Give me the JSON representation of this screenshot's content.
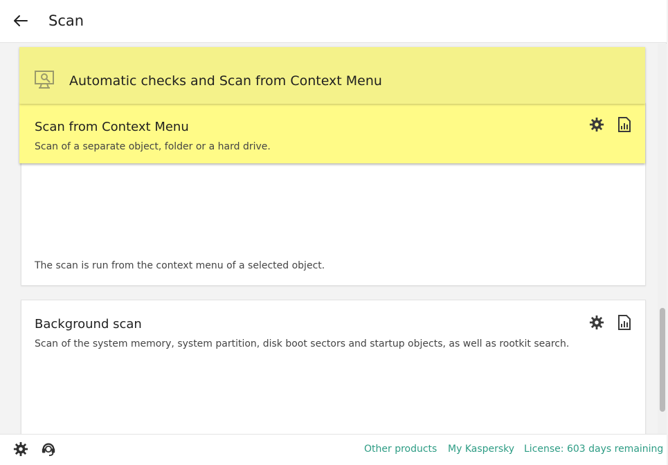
{
  "header": {
    "title": "Scan",
    "back_icon": "back-arrow-icon"
  },
  "section": {
    "title": "Automatic checks and Scan from Context Menu",
    "icon": "monitor-search-icon",
    "color": "#f4f28a"
  },
  "cards": [
    {
      "title": "Scan from Context Menu",
      "description": "Scan of a separate object, folder or a hard drive.",
      "note": "The scan is run from the context menu of a selected object.",
      "highlight_color": "#fffb87",
      "actions": [
        "gear-icon",
        "report-icon"
      ]
    },
    {
      "title": "Background scan",
      "description": "Scan of the system memory, system partition, disk boot sectors and startup objects, as well as rootkit search.",
      "actions": [
        "gear-icon",
        "report-icon"
      ]
    }
  ],
  "footer": {
    "icons": [
      "gear-icon",
      "support-icon"
    ],
    "links": {
      "other_products": "Other products",
      "my_kaspersky": "My Kaspersky",
      "license": "License: 603 days remaining"
    },
    "link_color": "#2d9c84"
  }
}
